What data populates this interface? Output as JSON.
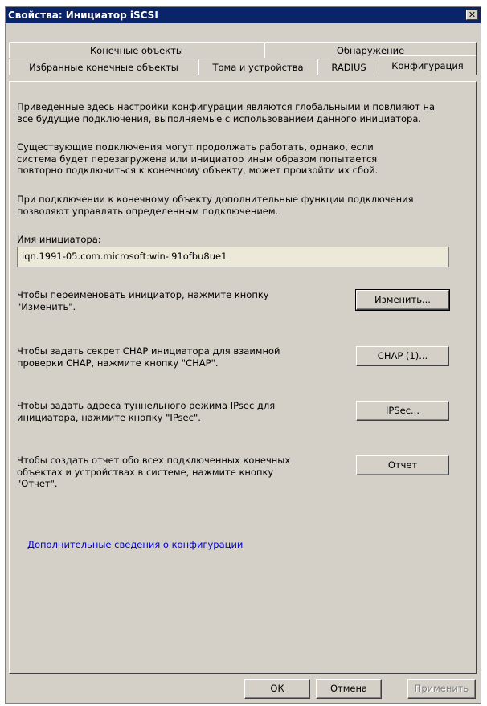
{
  "window": {
    "title": "Свойства: Инициатор iSCSI",
    "close_glyph": "✕"
  },
  "tabs": {
    "row1": [
      "Конечные объекты",
      "Обнаружение"
    ],
    "row2": [
      "Избранные конечные объекты",
      "Тома и устройства",
      "RADIUS",
      "Конфигурация"
    ]
  },
  "content": {
    "para1": "Приведенные здесь настройки конфигурации являются глобальными и повлияют на\nвсе будущие подключения, выполняемые с использованием данного инициатора.",
    "para2": "Существующие подключения могут продолжать работать, однако, если\nсистема будет перезагружена или инициатор иным образом попытается\nповторно подключиться к конечному объекту, может произойти их сбой.",
    "para3": "При подключении к конечному объекту дополнительные функции подключения\nпозволяют управлять определенным подключением.",
    "initiator_label": "Имя инициатора:",
    "initiator_value": "iqn.1991-05.com.microsoft:win-l91ofbu8ue1",
    "rename_text": "Чтобы переименовать инициатор, нажмите кнопку\n\"Изменить\".",
    "rename_button": "Изменить...",
    "chap_text": "Чтобы задать секрет CHAP инициатора для взаимной\nпроверки CHAP, нажмите кнопку \"CHAP\".",
    "chap_button": "CHAP (1)...",
    "ipsec_text": "Чтобы задать адреса туннельного режима IPsec для\nинициатора, нажмите кнопку \"IPsec\".",
    "ipsec_button": "IPSec...",
    "report_text": "Чтобы создать отчет обо всех подключенных конечных\nобъектах и устройствах в системе, нажмите кнопку\n\"Отчет\".",
    "report_button": "Отчет",
    "more_info_link": "Дополнительные сведения о конфигурации"
  },
  "footer": {
    "ok": "ОК",
    "cancel": "Отмена",
    "apply": "Применить"
  }
}
